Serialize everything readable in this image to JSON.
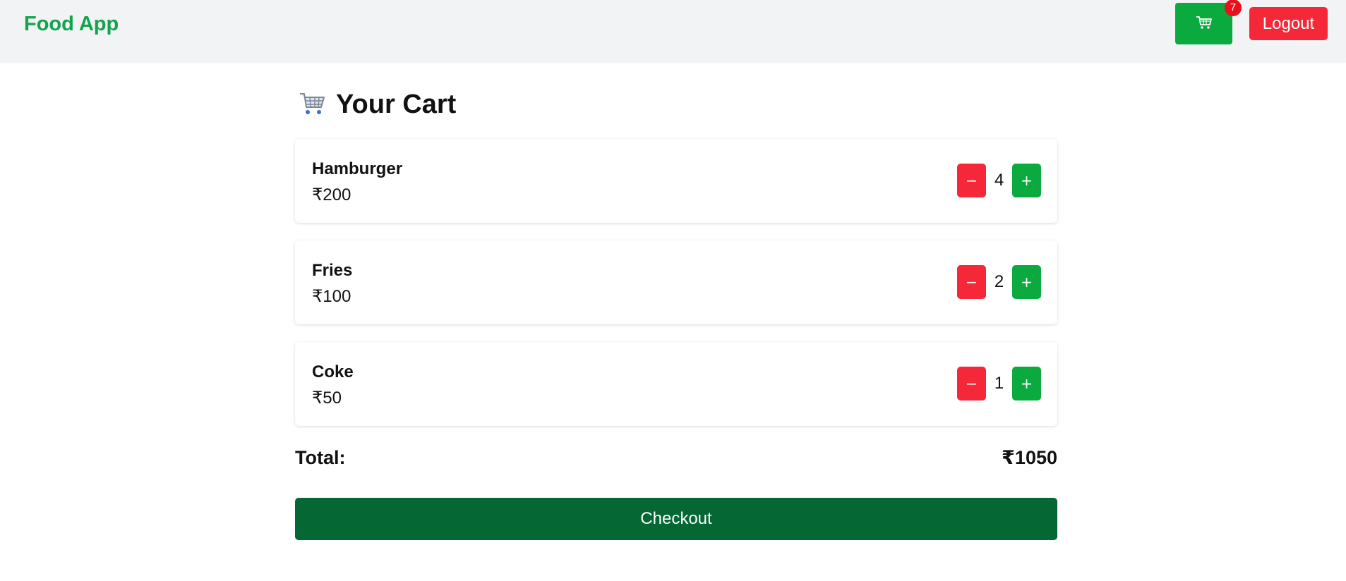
{
  "app": {
    "brand": "Food App"
  },
  "header": {
    "cart_icon": "shopping-cart-icon",
    "cart_count": "7",
    "logout_label": "Logout"
  },
  "cart": {
    "title_icon": "shopping-cart-icon",
    "title": "Your Cart",
    "items": [
      {
        "name": "Hamburger",
        "price": "₹200",
        "quantity": "4",
        "decrease_label": "−",
        "increase_label": "+"
      },
      {
        "name": "Fries",
        "price": "₹100",
        "quantity": "2",
        "decrease_label": "−",
        "increase_label": "+"
      },
      {
        "name": "Coke",
        "price": "₹50",
        "quantity": "1",
        "decrease_label": "−",
        "increase_label": "+"
      }
    ],
    "total_label": "Total:",
    "total_value": "₹1050",
    "checkout_label": "Checkout"
  },
  "colors": {
    "brand": "#13a34a",
    "primary_green": "#0aaa3f",
    "danger_red": "#f42838",
    "checkout_green": "#046734",
    "badge_red": "#e8101c"
  }
}
